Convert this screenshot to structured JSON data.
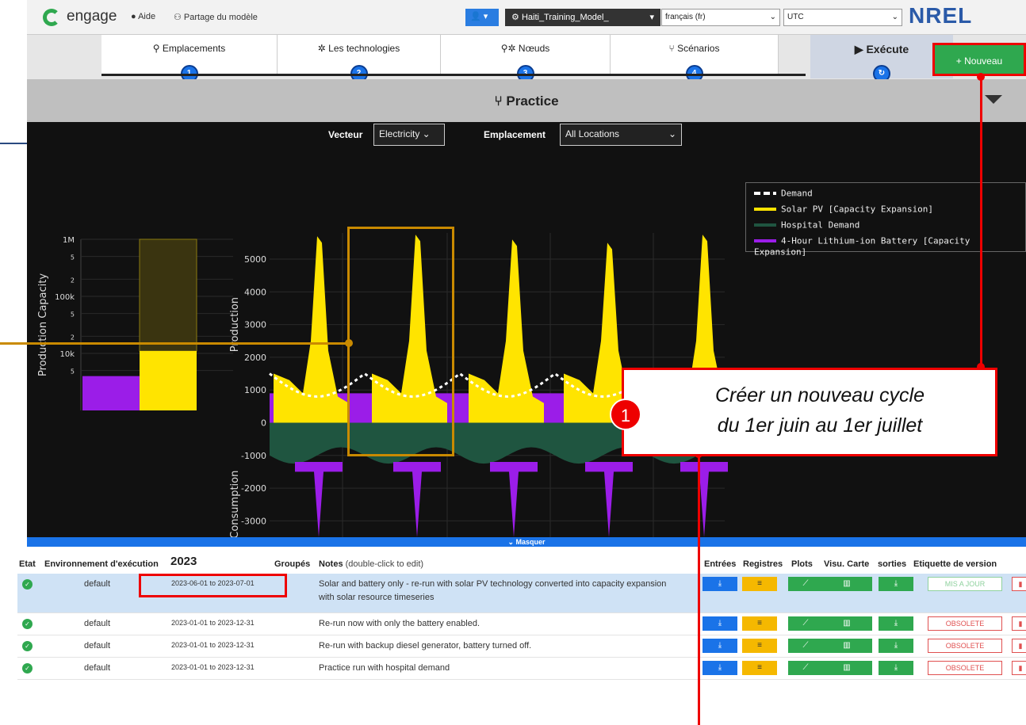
{
  "header": {
    "brand": "engage",
    "help": "Aide",
    "share": "Partage du modèle",
    "user_icon": "user-icon",
    "model": "Haiti_Training_Model_",
    "language": "français (fr)",
    "timezone": "UTC",
    "partner_logo": "NREL"
  },
  "nav": {
    "tabs": [
      {
        "label": "Emplacements",
        "num": "1",
        "icon": "location-pin-icon"
      },
      {
        "label": "Les technologies",
        "num": "2",
        "icon": "gear-icon"
      },
      {
        "label": "Nœuds",
        "num": "3",
        "icon": "node-icon"
      },
      {
        "label": "Scénarios",
        "num": "4",
        "icon": "branch-icon"
      }
    ],
    "execute": "Exécute",
    "new_button": "+ Nouveau"
  },
  "project": {
    "title": "Practice"
  },
  "filters": {
    "vector_label": "Vecteur",
    "vector_value": "Electricity",
    "location_label": "Emplacement",
    "location_value": "All Locations"
  },
  "chart_data": [
    {
      "type": "bar",
      "ylabel": "Production Capacity",
      "yscale": "log",
      "ytick_labels": [
        "5",
        "10k",
        "2",
        "5",
        "100k",
        "2",
        "5",
        "1M"
      ],
      "series": [
        {
          "name": "4-Hour Lithium-ion Battery [Capacity Expansion]",
          "color": "#9b1de8",
          "values": [
            4000
          ]
        },
        {
          "name": "Solar PV [Capacity Expansion]",
          "color": "#ffe400",
          "values": [
            11000
          ]
        }
      ]
    },
    {
      "type": "area",
      "ylabel_top": "Production",
      "ylabel_bottom": "Consumption",
      "ylim": [
        -3500,
        5800
      ],
      "yticks": [
        5000,
        4000,
        3000,
        2000,
        1000,
        0,
        -1000,
        -2000,
        -3000
      ],
      "legend_placement": "top-right",
      "series": [
        {
          "name": "Demand",
          "color": "#ffffff",
          "style": "dashed"
        },
        {
          "name": "Solar PV [Capacity Expansion]",
          "color": "#ffe400",
          "peaks": [
            5700,
            5750,
            5600,
            5500,
            5750
          ]
        },
        {
          "name": "Hospital Demand",
          "color": "#1f5540",
          "values_approx": -1000
        },
        {
          "name": "4-Hour Lithium-ion Battery [Capacity Expansion]",
          "color": "#9b1de8",
          "values_approx": 900
        }
      ]
    }
  ],
  "collapse_bar": "Masquer",
  "runs": {
    "headers": {
      "state": "Etat",
      "env": "Environnement d'exécution",
      "year": "2023",
      "groups": "Groupés",
      "notes": "Notes",
      "notes_hint": "(double-click to edit)",
      "inputs": "Entrées",
      "logs": "Registres",
      "plots": "Plots",
      "map": "Visu. Carte",
      "outputs": "sorties",
      "version": "Etiquette de version"
    },
    "rows": [
      {
        "env": "default",
        "range": "2023-06-01 to 2023-07-01",
        "notes": "Solar and battery only - re-run with solar PV technology converted into capacity expansion with solar resource timeseries",
        "status": "MIS A JOUR"
      },
      {
        "env": "default",
        "range": "2023-01-01 to 2023-12-31",
        "notes": "Re-run now with only the battery enabled.",
        "status": "OBSOLETE"
      },
      {
        "env": "default",
        "range": "2023-01-01 to 2023-12-31",
        "notes": "Re-run with backup diesel generator, battery turned off.",
        "status": "OBSOLETE"
      },
      {
        "env": "default",
        "range": "2023-01-01 to 2023-12-31",
        "notes": "Practice run with hospital demand",
        "status": "OBSOLETE"
      }
    ]
  },
  "annotation": {
    "badge": "1",
    "line1": "Créer un nouveau cycle",
    "line2": "du 1er juin au 1er juillet"
  }
}
